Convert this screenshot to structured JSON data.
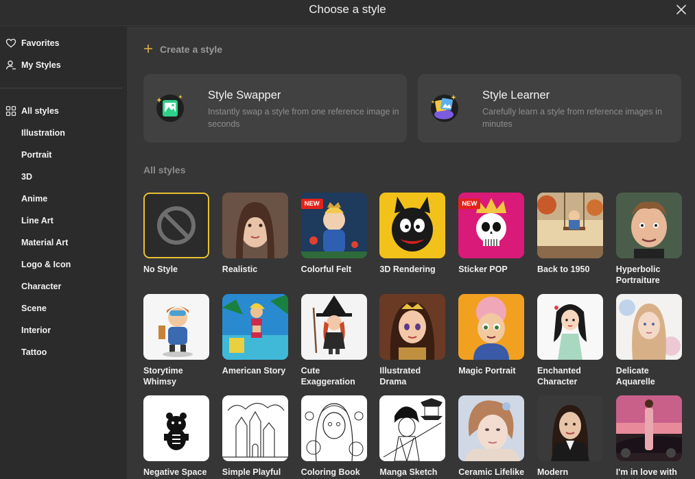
{
  "header": {
    "title": "Choose a style"
  },
  "sidebar": {
    "top_items": [
      {
        "label": "Favorites",
        "icon": "heart-icon"
      },
      {
        "label": "My Styles",
        "icon": "user-icon"
      }
    ],
    "all_label": "All styles",
    "categories": [
      "Illustration",
      "Portrait",
      "3D",
      "Anime",
      "Line Art",
      "Material Art",
      "Logo & Icon",
      "Character",
      "Scene",
      "Interior",
      "Tattoo"
    ]
  },
  "main": {
    "create_label": "Create a style",
    "cards": [
      {
        "title": "Style Swapper",
        "desc": "Instantly swap a style from one reference image in seconds",
        "icon": "image-sparkle-icon"
      },
      {
        "title": "Style Learner",
        "desc": "Carefully learn a style from reference images in minutes",
        "icon": "image-stack-sparkle-icon"
      }
    ],
    "section_title": "All styles",
    "new_badge": "NEW",
    "styles": [
      "No Style",
      "Realistic",
      "Colorful Felt",
      "3D Rendering",
      "Sticker POP",
      "Back to 1950",
      "Hyperbolic Portraiture",
      "Storytime Whimsy",
      "American Story",
      "Cute Exaggeration",
      "Illustrated Drama",
      "Magic Portrait",
      "Enchanted Character",
      "Delicate Aquarelle",
      "Negative Space",
      "Simple Playful",
      "Coloring Book",
      "Manga Sketch",
      "Ceramic Lifelike",
      "Modern",
      "I'm in love with"
    ]
  },
  "colors": {
    "accent": "#e8c233",
    "badge": "#e2231a",
    "panel": "#363636",
    "sidebar": "#2b2b2b",
    "card": "#414141"
  }
}
